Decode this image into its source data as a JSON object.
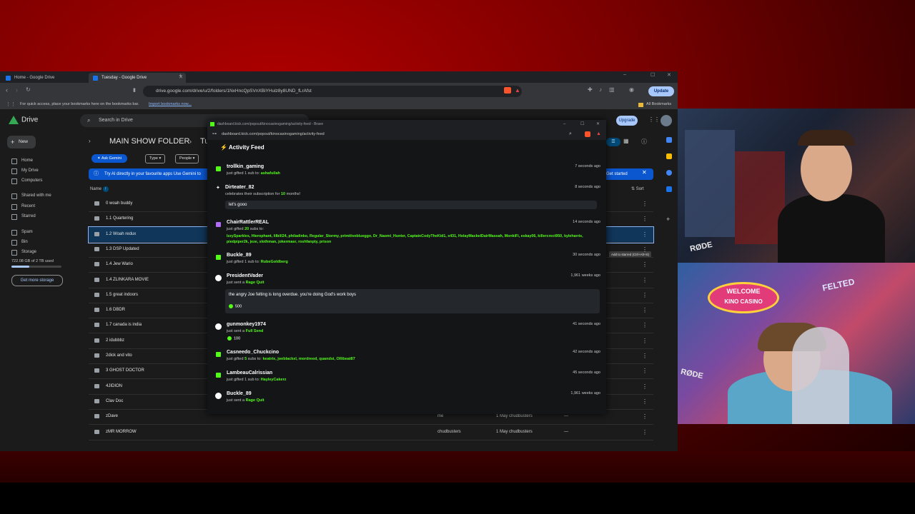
{
  "browser": {
    "tabs": [
      {
        "label": "Home - Google Drive"
      },
      {
        "label": "Tuesday - Google Drive"
      }
    ],
    "url": "drive.google.com/drive/u/2/folders/1NxHncQpSVnXBiYHulz8y8UND_fLrAfst",
    "update_label": "Update",
    "bookmarks_hint": "For quick access, place your bookmarks here on the bookmarks bar.",
    "import_link": "Import bookmarks now...",
    "all_bookmarks": "All Bookmarks"
  },
  "drive": {
    "app_name": "Drive",
    "search_placeholder": "Search in Drive",
    "new_label": "New",
    "upgrade_label": "Upgrade",
    "nav": [
      "Home",
      "My Drive",
      "Computers",
      "Shared with me",
      "Recent",
      "Starred",
      "Spam",
      "Bin",
      "Storage"
    ],
    "storage_text": "722.08 GB of 2 TB used",
    "storage_fraction": 0.36,
    "get_storage": "Get more storage",
    "folder_title": "MAIN SHOW FOLDER",
    "breadcrumb_next": "Tu",
    "ask_gemini": "Ask Gemini",
    "filters": [
      "Type",
      "People"
    ],
    "banner_text": "Try AI directly in your favourite apps  Use Gemini to",
    "get_started": "Get started",
    "col_name": "Name",
    "sort_label": "Sort",
    "tooltip": "Add to starred (Ctrl+Alt+S)",
    "files": [
      {
        "name": "0 woah buddy",
        "owner": "",
        "modified": "",
        "size": ""
      },
      {
        "name": "1.1 Quartering",
        "owner": "",
        "modified": "",
        "size": ""
      },
      {
        "name": "1.2 Woah redux",
        "owner": "",
        "modified": "",
        "size": ""
      },
      {
        "name": "1.3 DSP Updated",
        "owner": "",
        "modified": "",
        "size": ""
      },
      {
        "name": "1.4 Jew Wario",
        "owner": "",
        "modified": "",
        "size": ""
      },
      {
        "name": "1.4 ZLINKARA MOVIE",
        "owner": "",
        "modified": "",
        "size": ""
      },
      {
        "name": "1.5 great indoors",
        "owner": "",
        "modified": "",
        "size": ""
      },
      {
        "name": "1.6 DBDR",
        "owner": "",
        "modified": "",
        "size": ""
      },
      {
        "name": "1.7 canada is india",
        "owner": "",
        "modified": "",
        "size": ""
      },
      {
        "name": "2 idubbbz",
        "owner": "",
        "modified": "",
        "size": ""
      },
      {
        "name": "2dick and vito",
        "owner": "",
        "modified": "",
        "size": ""
      },
      {
        "name": "3 GHOST DOCTOR",
        "owner": "",
        "modified": "",
        "size": ""
      },
      {
        "name": "4JIDION",
        "owner": "",
        "modified": "",
        "size": ""
      },
      {
        "name": "Clav Doc",
        "owner": "",
        "modified": "",
        "size": ""
      },
      {
        "name": "zDave",
        "owner": "me",
        "modified": "1 May chudbusters",
        "size": "—"
      },
      {
        "name": "zMR MORROW",
        "owner": "chudbusters",
        "modified": "1 May chudbusters",
        "size": "—"
      }
    ]
  },
  "popout": {
    "window_title": "dashboard.kick.com/popout/kinocasinogaming/activity-feed - Brave",
    "url": "dashboard.kick.com/popout/kinocasinogaming/activity-feed",
    "feed_title": "Activity Feed",
    "events": [
      {
        "user": "trollkin_gaming",
        "time": "7 seconds ago",
        "line": "just gifted 1 sub to:",
        "highlight": "ashafullah",
        "icon": "gift"
      },
      {
        "user": "Dirteater_82",
        "time": "8 seconds ago",
        "line": "celebrates their subscription for",
        "highlight": "10",
        "line_end": "months!",
        "message": "let's gooo",
        "icon": "star"
      },
      {
        "user": "ChairRattlerREAL",
        "time": "14 seconds ago",
        "line": "just gifted",
        "highlight": "20",
        "line_end": "subs to:",
        "recipients": "IzzySparkles, Hierophant, lilbill24, philadinko, Regular_Stormy, primitiveblueggo, Dr_Naomi_Hunter, CaptainCodyTheKid1, x431, HolayMackelDairMassah, MonkiFi, eskay06, killercrect950, kyleharris, piedpiper2k, jeze, slothman, jokermasr, roshfanpty, prison",
        "icon": "purple"
      },
      {
        "user": "Buckle_89",
        "time": "30 seconds ago",
        "line": "just gifted 1 sub to:",
        "highlight": "RubeGoldberg",
        "icon": "gift"
      },
      {
        "user": "PresidentVader",
        "time": "1,961 weeks ago",
        "line": "just sent a",
        "highlight": "Rage Quit",
        "message": "the angry Joe felting is long overdue. you're doing God's work boys",
        "amount": "500",
        "icon": "kick"
      },
      {
        "user": "gunmonkey1974",
        "time": "41 seconds ago",
        "line": "just sent a",
        "highlight": "Full Send",
        "amount": "100",
        "icon": "kick"
      },
      {
        "user": "Casneedo_Chuckcino",
        "time": "42 seconds ago",
        "line": "just gifted",
        "highlight": "5",
        "line_end": "subs to:",
        "recipients": "keatrix, joeblackxl, mordreed, quandsi, Ollibeat87",
        "icon": "gift"
      },
      {
        "user": "LambeauCalrissian",
        "time": "45 seconds ago",
        "line": "just gifted 1 sub to:",
        "highlight": "HayleyCakerz",
        "icon": "gift"
      },
      {
        "user": "Buckle_89",
        "time": "1,961 weeks ago",
        "line": "just sent a",
        "highlight": "Rage Quit",
        "icon": "kick"
      }
    ]
  },
  "overlay": {
    "welcome_sign": "WELCOME",
    "kino_casino": "KINO CASINO",
    "felted_sign": "FELTED",
    "rode_label": "RØDE"
  }
}
